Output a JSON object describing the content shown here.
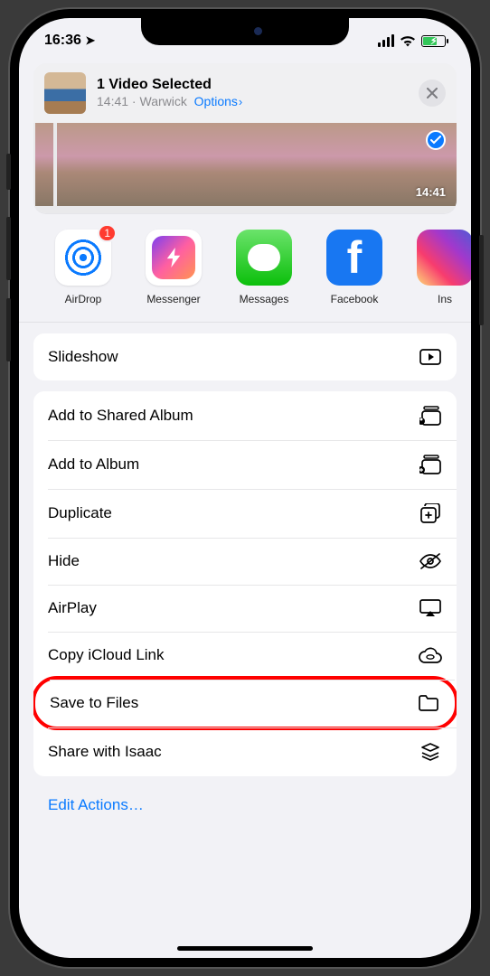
{
  "status": {
    "time": "16:36"
  },
  "header": {
    "title": "1 Video Selected",
    "sub_time": "14:41",
    "sub_sep": " · ",
    "sub_location": "Warwick",
    "options_label": "Options"
  },
  "preview": {
    "duration": "14:41"
  },
  "apps": [
    {
      "id": "airdrop",
      "label": "AirDrop",
      "badge": "1"
    },
    {
      "id": "messenger",
      "label": "Messenger"
    },
    {
      "id": "messages",
      "label": "Messages"
    },
    {
      "id": "facebook",
      "label": "Facebook",
      "glyph": "f"
    },
    {
      "id": "instagram",
      "label": "Ins"
    }
  ],
  "action_groups": [
    {
      "rows": [
        {
          "id": "slideshow",
          "label": "Slideshow",
          "icon": "play-rect"
        }
      ]
    },
    {
      "rows": [
        {
          "id": "add-shared-album",
          "label": "Add to Shared Album",
          "icon": "album-person"
        },
        {
          "id": "add-album",
          "label": "Add to Album",
          "icon": "album-plus"
        },
        {
          "id": "duplicate",
          "label": "Duplicate",
          "icon": "square-plus"
        },
        {
          "id": "hide",
          "label": "Hide",
          "icon": "eye-slash"
        },
        {
          "id": "airplay",
          "label": "AirPlay",
          "icon": "airplay"
        },
        {
          "id": "copy-icloud",
          "label": "Copy iCloud Link",
          "icon": "cloud-link"
        },
        {
          "id": "save-files",
          "label": "Save to Files",
          "icon": "folder",
          "highlight": true
        },
        {
          "id": "share-isaac",
          "label": "Share with Isaac",
          "icon": "stack"
        }
      ]
    }
  ],
  "footer": {
    "edit_actions": "Edit Actions…"
  }
}
